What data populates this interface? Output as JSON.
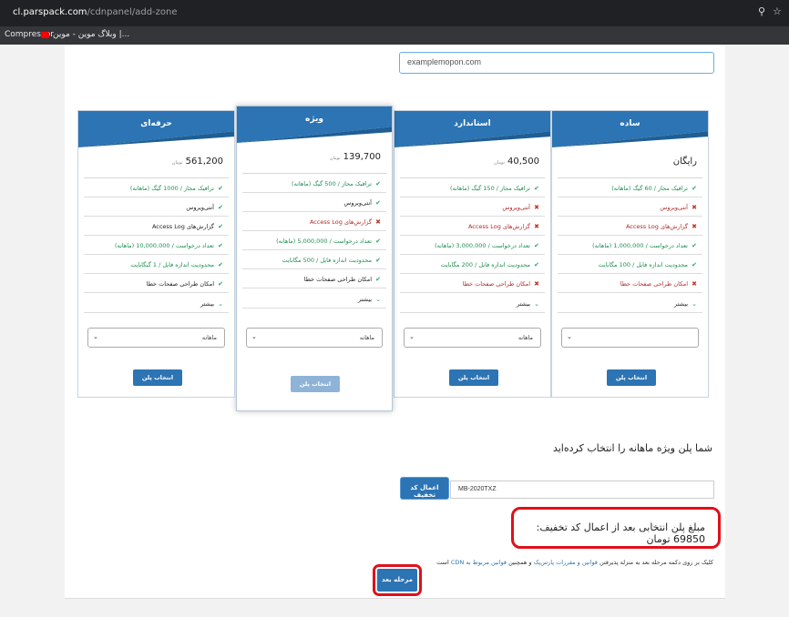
{
  "browser": {
    "url_host": "cl.parspack.com",
    "url_path": "/cdnpanel/add-zone",
    "bookmarks": [
      {
        "label": "Compressor"
      },
      {
        "label": "وبلاگ موین - موین |..."
      }
    ]
  },
  "domain_field": {
    "value": "examplemopon.com"
  },
  "plans": [
    {
      "title": "ساده",
      "price_main": "رایگان",
      "price_small": "",
      "features": [
        {
          "ok": true,
          "mark": "✔",
          "text": "ترافیک مجاز / 60 گیگ (ماهانه)",
          "tone": "green"
        },
        {
          "ok": false,
          "mark": "✖",
          "text": "آنتی‌ویروس",
          "tone": "red"
        },
        {
          "ok": false,
          "mark": "✖",
          "text": "گزارش‌های Access Log",
          "tone": "red"
        },
        {
          "ok": true,
          "mark": "✔",
          "text": "تعداد درخواست / 1,000,000 (ماهانه)",
          "tone": "green"
        },
        {
          "ok": true,
          "mark": "✔",
          "text": "محدودیت اندازه فایل / 100 مگابایت",
          "tone": "green"
        },
        {
          "ok": false,
          "mark": "✖",
          "text": "امکان طراحی صفحات خطا",
          "tone": "red"
        }
      ],
      "more_label": "بیشتر",
      "period": "",
      "button_label": "انتخاب پلن"
    },
    {
      "title": "استاندارد",
      "price_main": "40,500",
      "price_small": "تومان",
      "features": [
        {
          "ok": true,
          "mark": "✔",
          "text": "ترافیک مجاز / 150 گیگ (ماهانه)",
          "tone": "green"
        },
        {
          "ok": false,
          "mark": "✖",
          "text": "آنتی‌ویروس",
          "tone": "red"
        },
        {
          "ok": false,
          "mark": "✖",
          "text": "گزارش‌های Access Log",
          "tone": "red"
        },
        {
          "ok": true,
          "mark": "✔",
          "text": "تعداد درخواست / 3,000,000 (ماهانه)",
          "tone": "green"
        },
        {
          "ok": true,
          "mark": "✔",
          "text": "محدودیت اندازه فایل / 200 مگابایت",
          "tone": "green"
        },
        {
          "ok": false,
          "mark": "✖",
          "text": "امکان طراحی صفحات خطا",
          "tone": "red"
        }
      ],
      "more_label": "بیشتر",
      "period": "ماهانه",
      "button_label": "انتخاب پلن"
    },
    {
      "title": "ویژه",
      "price_main": "139,700",
      "price_small": "تومان",
      "features": [
        {
          "ok": true,
          "mark": "✔",
          "text": "ترافیک مجاز / 500 گیگ (ماهانه)",
          "tone": "green"
        },
        {
          "ok": true,
          "mark": "✔",
          "text": "آنتی‌ویروس",
          "tone": "dark"
        },
        {
          "ok": false,
          "mark": "✖",
          "text": "گزارش‌های Access Log",
          "tone": "red"
        },
        {
          "ok": true,
          "mark": "✔",
          "text": "تعداد درخواست / 5,000,000 (ماهانه)",
          "tone": "green"
        },
        {
          "ok": true,
          "mark": "✔",
          "text": "محدودیت اندازه فایل / 500 مگابایت",
          "tone": "green"
        },
        {
          "ok": true,
          "mark": "✔",
          "text": "امکان طراحی صفحات خطا",
          "tone": "dark"
        }
      ],
      "more_label": "بیشتر",
      "period": "ماهانه",
      "button_label": "انتخاب پلن"
    },
    {
      "title": "حرفه‌ای",
      "price_main": "561,200",
      "price_small": "تومان",
      "features": [
        {
          "ok": true,
          "mark": "✔",
          "text": "ترافیک مجاز / 1000 گیگ (ماهانه)",
          "tone": "green"
        },
        {
          "ok": true,
          "mark": "✔",
          "text": "آنتی‌ویروس",
          "tone": "dark"
        },
        {
          "ok": true,
          "mark": "✔",
          "text": "گزارش‌های Access Log",
          "tone": "dark"
        },
        {
          "ok": true,
          "mark": "✔",
          "text": "تعداد درخواست / 10,000,000 (ماهانه)",
          "tone": "green"
        },
        {
          "ok": true,
          "mark": "✔",
          "text": "محدودیت اندازه فایل / 1 گیگابایت",
          "tone": "green"
        },
        {
          "ok": true,
          "mark": "✔",
          "text": "امکان طراحی صفحات خطا",
          "tone": "dark"
        }
      ],
      "more_label": "بیشتر",
      "period": "ماهانه",
      "button_label": "انتخاب پلن"
    }
  ],
  "summary": {
    "selected_text": "شما پلن ویژه ماهانه را انتخاب کرده‌اید",
    "coupon_button": "اعمال کد تخفیف",
    "coupon_value": "MB-2020TXZ",
    "final_text": "مبلغ پلن انتخابی بعد از اعمال کد تخفیف: 69850 تومان",
    "terms_part1": "کلیک بر روی دکمه مرحله بعد به منزله پذیرفتن",
    "terms_link1": "قوانین و مقررات پارس‌پک",
    "terms_part2": "و همچنین",
    "terms_link2": "قوانین مربوط به CDN",
    "terms_part3": "است",
    "next_button": "مرحله بعد"
  },
  "colors": {
    "primary": "#2c74b3",
    "highlight": "#e0101a",
    "check": "#2aa36a",
    "cross": "#c0392b"
  }
}
